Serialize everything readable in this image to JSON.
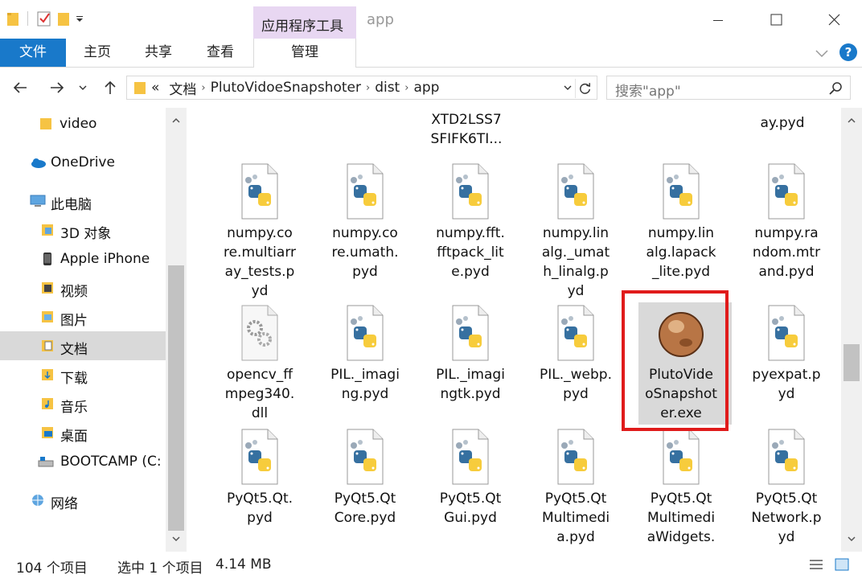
{
  "window": {
    "title": "app",
    "context_tab": "应用程序工具"
  },
  "ribbon": {
    "file": "文件",
    "tabs": [
      "主页",
      "共享",
      "查看"
    ],
    "manage": "管理"
  },
  "address": {
    "prefix": "«",
    "crumbs": [
      "文档",
      "PlutoVidoeSnapshoter",
      "dist",
      "app"
    ]
  },
  "search": {
    "placeholder": "搜索\"app\""
  },
  "navpane": {
    "items": [
      {
        "label": "video",
        "icon": "folder-icon"
      },
      {
        "label": "OneDrive",
        "icon": "cloud-icon"
      },
      {
        "label": "此电脑",
        "icon": "computer-icon"
      },
      {
        "label": "3D 对象",
        "icon": "3d-objects-icon"
      },
      {
        "label": "Apple iPhone",
        "icon": "phone-icon"
      },
      {
        "label": "视频",
        "icon": "video-folder-icon"
      },
      {
        "label": "图片",
        "icon": "pictures-folder-icon"
      },
      {
        "label": "文档",
        "icon": "documents-folder-icon"
      },
      {
        "label": "下载",
        "icon": "downloads-folder-icon"
      },
      {
        "label": "音乐",
        "icon": "music-folder-icon"
      },
      {
        "label": "桌面",
        "icon": "desktop-folder-icon"
      },
      {
        "label": "BOOTCAMP (C:",
        "icon": "drive-icon"
      },
      {
        "label": "网络",
        "icon": "network-icon"
      }
    ]
  },
  "files": {
    "partial_top": [
      "XTD2LSS7\nSFIFK6TI...",
      "ay.pyd"
    ],
    "row1": [
      "numpy.co\nre.multiarr\nay_tests.p\nyd",
      "numpy.co\nre.umath.\npyd",
      "numpy.fft.\nfftpack_lit\ne.pyd",
      "numpy.lin\nalg._umat\nh_linalg.p\nyd",
      "numpy.lin\nalg.lapack\n_lite.pyd",
      "numpy.ra\nndom.mtr\nand.pyd"
    ],
    "row2": [
      "opencv_ff\nmpeg340.\ndll",
      "PIL._imagi\nng.pyd",
      "PIL._imagi\nngtk.pyd",
      "PIL._webp.\npyd",
      "PlutoVide\noSnapshot\ner.exe",
      "pyexpat.p\nyd"
    ],
    "row3": [
      "PyQt5.Qt.\npyd",
      "PyQt5.Qt\nCore.pyd",
      "PyQt5.Qt\nGui.pyd",
      "PyQt5.Qt\nMultimedi\na.pyd",
      "PyQt5.Qt\nMultimedi\naWidgets.",
      "PyQt5.Qt\nNetwork.p\nyd"
    ]
  },
  "status": {
    "count": "104 个项目",
    "selected": "选中 1 个项目",
    "size": "4.14 MB"
  },
  "colors": {
    "accent": "#1979ca",
    "context_tab": "#e8d7f2",
    "highlight": "#e01b1b",
    "selection": "#d9d9d9"
  }
}
